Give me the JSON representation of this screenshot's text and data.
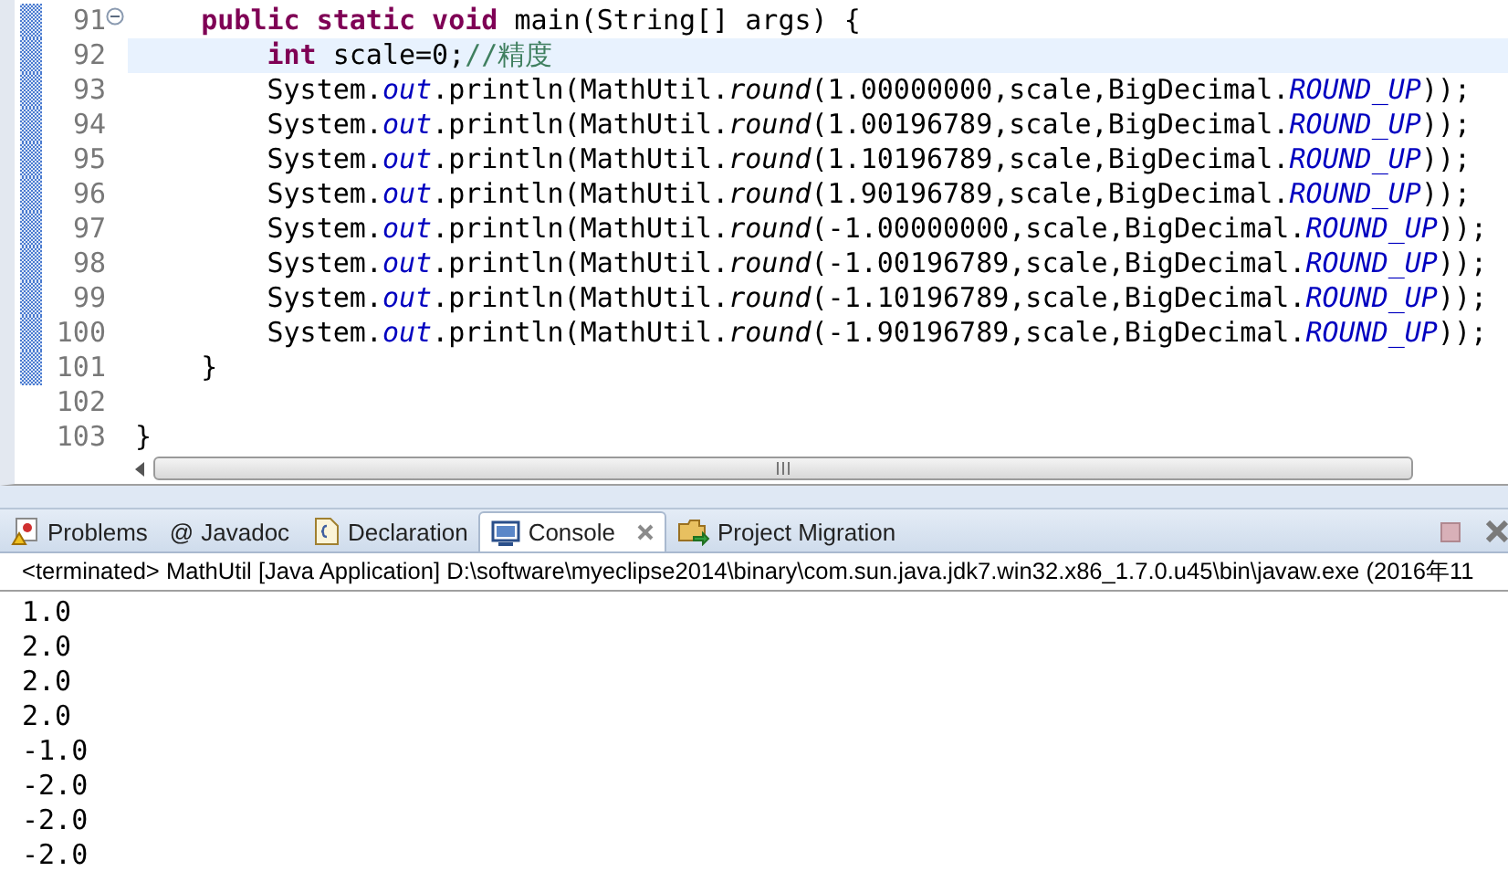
{
  "editor": {
    "lines": [
      {
        "number": "91",
        "changed": true,
        "foldable": true,
        "selected": false,
        "tokens": [
          {
            "text": "    public static void",
            "kind": "keyword"
          },
          {
            "text": " main(String[] args) {",
            "kind": "plain"
          }
        ]
      },
      {
        "number": "92",
        "changed": true,
        "foldable": false,
        "selected": true,
        "tokens": [
          {
            "text": "        int",
            "kind": "keyword"
          },
          {
            "text": " scale=0;",
            "kind": "plain"
          },
          {
            "text": "//精度",
            "kind": "comment"
          }
        ]
      },
      {
        "number": "93",
        "changed": true,
        "foldable": false,
        "selected": false,
        "tokens": [
          {
            "text": "        System.",
            "kind": "plain"
          },
          {
            "text": "out",
            "kind": "field"
          },
          {
            "text": ".println(MathUtil.",
            "kind": "plain"
          },
          {
            "text": "round",
            "kind": "method"
          },
          {
            "text": "(1.00000000,scale,BigDecimal.",
            "kind": "plain"
          },
          {
            "text": "ROUND_UP",
            "kind": "field"
          },
          {
            "text": "));",
            "kind": "plain"
          }
        ]
      },
      {
        "number": "94",
        "changed": true,
        "foldable": false,
        "selected": false,
        "tokens": [
          {
            "text": "        System.",
            "kind": "plain"
          },
          {
            "text": "out",
            "kind": "field"
          },
          {
            "text": ".println(MathUtil.",
            "kind": "plain"
          },
          {
            "text": "round",
            "kind": "method"
          },
          {
            "text": "(1.00196789,scale,BigDecimal.",
            "kind": "plain"
          },
          {
            "text": "ROUND_UP",
            "kind": "field"
          },
          {
            "text": "));",
            "kind": "plain"
          }
        ]
      },
      {
        "number": "95",
        "changed": true,
        "foldable": false,
        "selected": false,
        "tokens": [
          {
            "text": "        System.",
            "kind": "plain"
          },
          {
            "text": "out",
            "kind": "field"
          },
          {
            "text": ".println(MathUtil.",
            "kind": "plain"
          },
          {
            "text": "round",
            "kind": "method"
          },
          {
            "text": "(1.10196789,scale,BigDecimal.",
            "kind": "plain"
          },
          {
            "text": "ROUND_UP",
            "kind": "field"
          },
          {
            "text": "));",
            "kind": "plain"
          }
        ]
      },
      {
        "number": "96",
        "changed": true,
        "foldable": false,
        "selected": false,
        "tokens": [
          {
            "text": "        System.",
            "kind": "plain"
          },
          {
            "text": "out",
            "kind": "field"
          },
          {
            "text": ".println(MathUtil.",
            "kind": "plain"
          },
          {
            "text": "round",
            "kind": "method"
          },
          {
            "text": "(1.90196789,scale,BigDecimal.",
            "kind": "plain"
          },
          {
            "text": "ROUND_UP",
            "kind": "field"
          },
          {
            "text": "));",
            "kind": "plain"
          }
        ]
      },
      {
        "number": "97",
        "changed": true,
        "foldable": false,
        "selected": false,
        "tokens": [
          {
            "text": "        System.",
            "kind": "plain"
          },
          {
            "text": "out",
            "kind": "field"
          },
          {
            "text": ".println(MathUtil.",
            "kind": "plain"
          },
          {
            "text": "round",
            "kind": "method"
          },
          {
            "text": "(-1.00000000,scale,BigDecimal.",
            "kind": "plain"
          },
          {
            "text": "ROUND_UP",
            "kind": "field"
          },
          {
            "text": "));",
            "kind": "plain"
          }
        ]
      },
      {
        "number": "98",
        "changed": true,
        "foldable": false,
        "selected": false,
        "tokens": [
          {
            "text": "        System.",
            "kind": "plain"
          },
          {
            "text": "out",
            "kind": "field"
          },
          {
            "text": ".println(MathUtil.",
            "kind": "plain"
          },
          {
            "text": "round",
            "kind": "method"
          },
          {
            "text": "(-1.00196789,scale,BigDecimal.",
            "kind": "plain"
          },
          {
            "text": "ROUND_UP",
            "kind": "field"
          },
          {
            "text": "));",
            "kind": "plain"
          }
        ]
      },
      {
        "number": "99",
        "changed": true,
        "foldable": false,
        "selected": false,
        "tokens": [
          {
            "text": "        System.",
            "kind": "plain"
          },
          {
            "text": "out",
            "kind": "field"
          },
          {
            "text": ".println(MathUtil.",
            "kind": "plain"
          },
          {
            "text": "round",
            "kind": "method"
          },
          {
            "text": "(-1.10196789,scale,BigDecimal.",
            "kind": "plain"
          },
          {
            "text": "ROUND_UP",
            "kind": "field"
          },
          {
            "text": "));",
            "kind": "plain"
          }
        ]
      },
      {
        "number": "100",
        "changed": true,
        "foldable": false,
        "selected": false,
        "tokens": [
          {
            "text": "        System.",
            "kind": "plain"
          },
          {
            "text": "out",
            "kind": "field"
          },
          {
            "text": ".println(MathUtil.",
            "kind": "plain"
          },
          {
            "text": "round",
            "kind": "method"
          },
          {
            "text": "(-1.90196789,scale,BigDecimal.",
            "kind": "plain"
          },
          {
            "text": "ROUND_UP",
            "kind": "field"
          },
          {
            "text": "));",
            "kind": "plain"
          }
        ]
      },
      {
        "number": "101",
        "changed": true,
        "foldable": false,
        "selected": false,
        "tokens": [
          {
            "text": "    }",
            "kind": "plain"
          }
        ]
      },
      {
        "number": "102",
        "changed": false,
        "foldable": false,
        "selected": false
      },
      {
        "number": "103",
        "changed": false,
        "foldable": false,
        "selected": false,
        "tokens": [
          {
            "text": "}",
            "kind": "plain"
          }
        ]
      }
    ]
  },
  "views": {
    "tabs": [
      {
        "label": "Problems",
        "selected": false,
        "closable": false
      },
      {
        "label": "Javadoc",
        "prefix": "@",
        "selected": false,
        "closable": false
      },
      {
        "label": "Declaration",
        "selected": false,
        "closable": false
      },
      {
        "label": "Console",
        "selected": true,
        "closable": true
      },
      {
        "label": "Project Migration",
        "selected": false,
        "closable": false
      }
    ]
  },
  "console": {
    "header": "<terminated> MathUtil [Java Application] D:\\software\\myeclipse2014\\binary\\com.sun.java.jdk7.win32.x86_1.7.0.u45\\bin\\javaw.exe (2016年11",
    "output": [
      "1.0",
      "2.0",
      "2.0",
      "2.0",
      "-1.0",
      "-2.0",
      "-2.0",
      "-2.0"
    ]
  }
}
